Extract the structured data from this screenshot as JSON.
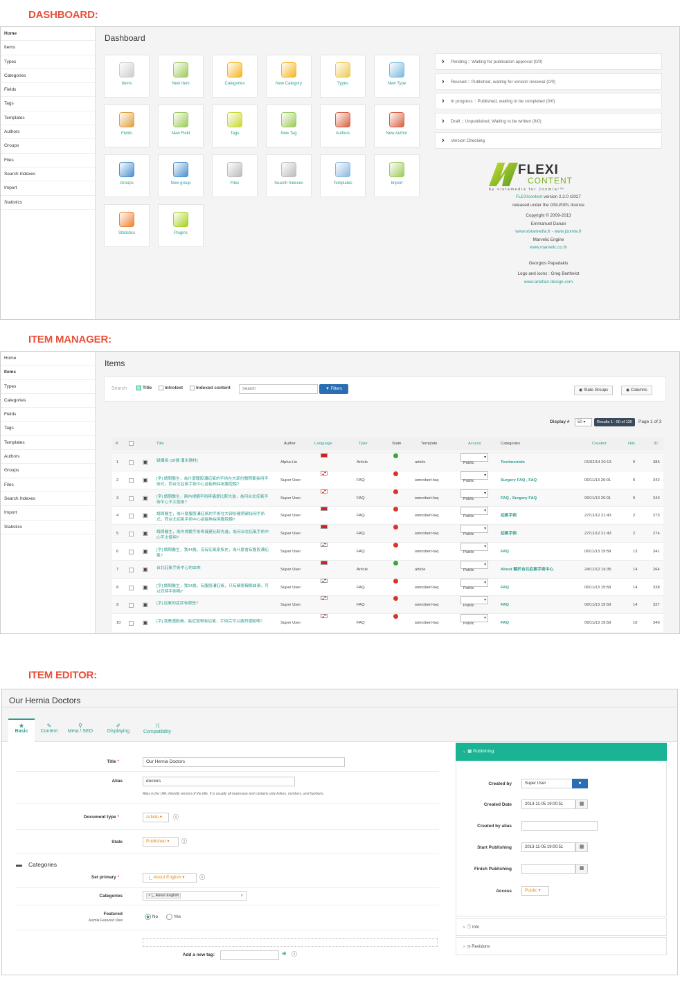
{
  "sections": {
    "dashboard": "DASHBOARD:",
    "manager": "ITEM MANAGER:",
    "editor": "ITEM EDITOR:"
  },
  "dashboard": {
    "sidebar": [
      "Home",
      "Items",
      "Types",
      "Categories",
      "Fields",
      "Tags",
      "Templates",
      "Authors",
      "Groups",
      "Files",
      "Search Indexes",
      "Import",
      "Statistics"
    ],
    "title": "Dashboard",
    "tiles": [
      {
        "label": "Items",
        "icon": "items-icon",
        "color": "#ccc"
      },
      {
        "label": "New Item",
        "icon": "new-item-icon",
        "color": "#9cca5a"
      },
      {
        "label": "Categories",
        "icon": "categories-icon",
        "color": "#f5b520"
      },
      {
        "label": "New Category",
        "icon": "new-category-icon",
        "color": "#f5b520"
      },
      {
        "label": "Types",
        "icon": "types-icon",
        "color": "#f0c850"
      },
      {
        "label": "New Type",
        "icon": "new-type-icon",
        "color": "#7ab8e0"
      },
      {
        "label": "Fields",
        "icon": "fields-icon",
        "color": "#e0a040"
      },
      {
        "label": "New Field",
        "icon": "new-field-icon",
        "color": "#9cca5a"
      },
      {
        "label": "Tags",
        "icon": "tags-icon",
        "color": "#c8d830"
      },
      {
        "label": "New Tag",
        "icon": "new-tag-icon",
        "color": "#9cca5a"
      },
      {
        "label": "Authors",
        "icon": "authors-icon",
        "color": "#d86040"
      },
      {
        "label": "New Author",
        "icon": "new-author-icon",
        "color": "#d86040"
      },
      {
        "label": "Groups",
        "icon": "groups-icon",
        "color": "#4a90d0"
      },
      {
        "label": "New group",
        "icon": "new-group-icon",
        "color": "#4a90d0"
      },
      {
        "label": "Files",
        "icon": "files-icon",
        "color": "#bbb"
      },
      {
        "label": "Search Indexes",
        "icon": "search-indexes-icon",
        "color": "#bbb"
      },
      {
        "label": "Templates",
        "icon": "templates-icon",
        "color": "#88b8e0"
      },
      {
        "label": "Import",
        "icon": "import-icon",
        "color": "#9cca5a"
      },
      {
        "label": "Statistics",
        "icon": "statistics-icon",
        "color": "#f08030"
      },
      {
        "label": "Plugins",
        "icon": "plugins-icon",
        "color": "#a8d020"
      }
    ],
    "status": [
      "Pending :: Waiting for publication approval (0/0)",
      "Revised :: Published, waiting for version reviewal (0/0)",
      "In progress :: Published, waiting to be completed (0/0)",
      "Draft :: Unpublished, Waiting to be written (0/0)",
      "Version Checking"
    ],
    "logo": {
      "main": "FLEXI",
      "sub": "CONTENT",
      "tagline": "by vistamedia for Joomla!™"
    },
    "credits": {
      "version_name": "FLEXIcontent",
      "version": "version 2.2.0 r2027",
      "licence": "released under the GNU/GPL licence",
      "copyright": "Copyright © 2009-2013",
      "author1": "Emmanuel Danan",
      "link1": "www.vistamedia.fr - www.joomla.fr",
      "engine": "Marvelic Engine",
      "link2": "www.marvelic.co.th",
      "author2": "Georgios Papadakis",
      "logo_credit": "Logo and icons : Greg Berthelot",
      "link3": "www.artefact-design.com"
    }
  },
  "manager": {
    "sidebar": [
      "Home",
      "Items",
      "Types",
      "Categories",
      "Fields",
      "Tags",
      "Templates",
      "Authors",
      "Groups",
      "Files",
      "Search Indexes",
      "Import",
      "Statistics"
    ],
    "title": "Items",
    "search_label": "Search",
    "opt_title": "Title",
    "opt_intro": "Introtext",
    "opt_indexed": "Indexed content",
    "search_placeholder": "Search",
    "filters": "Filters",
    "state_groups": "State Groups",
    "columns": "Columns",
    "display_label": "Display #",
    "display_value": "50",
    "results": "Results 1 - 50 of 130",
    "pages": "Page 1 of 3",
    "headers": [
      "#",
      "Title",
      "Author",
      "Language",
      "Type",
      "State",
      "Template",
      "Access",
      "Categories",
      "Created",
      "Hits",
      "ID"
    ],
    "rows": [
      {
        "n": "1",
        "title": "疑講長 (38號:潘永器材)",
        "author": "Alpha Lin",
        "lang": "tw",
        "type": "Article",
        "state": "ok",
        "tpl": "article",
        "access": "Public",
        "cats": "Testimonials",
        "created": "01/02/14 20:13",
        "hits": "0",
        "id": "385"
      },
      {
        "n": "2",
        "title": "[字] 請問醫生，為什麼腹股溝疝氣的手術在大部份醫院都採用手術式，而台北疝氣手術中心卻能夠採用腹腔鏡?",
        "author": "Super User",
        "lang": "uk",
        "type": "FAQ",
        "state": "no",
        "tpl": "iamrobert-faq",
        "access": "Public",
        "cats": "Surgery FAQ , FAQ",
        "created": "06/11/13 20:01",
        "hits": "0",
        "id": "342"
      },
      {
        "n": "3",
        "title": "[字] 請問醫生，兩內視鏡手術疼痛是比較先進，為何台北疝氣手術中心不太使用?",
        "author": "Super User",
        "lang": "uk",
        "type": "FAQ",
        "state": "no",
        "tpl": "iamrobert-faq",
        "access": "Public",
        "cats": "FAQ , Surgery FAQ",
        "created": "06/11/13 20:01",
        "hits": "0",
        "id": "343"
      },
      {
        "n": "4",
        "title": "請問醫生，為什麼腹股溝疝氣的手術在大部份醫院都採用手術式，而台北疝氣手術中心卻能夠採用腹腔鏡?",
        "author": "Super User",
        "lang": "tw",
        "type": "FAQ",
        "state": "no",
        "tpl": "iamrobert-faq",
        "access": "Public",
        "cats": "疝氣手術",
        "created": "27/12/12 21:43",
        "hits": "2",
        "id": "273"
      },
      {
        "n": "5",
        "title": "請問醫生，兩內視鏡手術疼痛是比較先進，為何台北疝氣手術中心不太使用?",
        "author": "Super User",
        "lang": "tw",
        "type": "FAQ",
        "state": "no",
        "tpl": "iamrobert-faq",
        "access": "Public",
        "cats": "疝氣手術",
        "created": "27/12/12 21:43",
        "hits": "2",
        "id": "274"
      },
      {
        "n": "6",
        "title": "[字] 請問醫生，我44歲，沒有疝氣家族史，為什麼會有腹股溝疝氣?",
        "author": "Super User",
        "lang": "uk",
        "type": "FAQ",
        "state": "no",
        "tpl": "iamrobert-faq",
        "access": "Public",
        "cats": "FAQ",
        "created": "06/11/13 19:58",
        "hits": "13",
        "id": "341"
      },
      {
        "n": "7",
        "title": "台北疝氣手術中心的由來",
        "author": "Super User",
        "lang": "tw",
        "type": "Article",
        "state": "ok",
        "tpl": "article",
        "access": "Public",
        "cats": "About 關於台北疝氣手術中心",
        "created": "24/12/12 16:35",
        "hits": "14",
        "id": "264"
      },
      {
        "n": "8",
        "title": "[字] 請問醫生，我24歲，有腹股溝疝氣，只有精索靜脈曲張，可以同時手術嗎?",
        "author": "Super User",
        "lang": "uk",
        "type": "FAQ",
        "state": "no",
        "tpl": "iamrobert-faq",
        "access": "Public",
        "cats": "FAQ",
        "created": "06/11/13 19:58",
        "hits": "14",
        "id": "338"
      },
      {
        "n": "9",
        "title": "[字] 疝氣的症狀有哪些?",
        "author": "Super User",
        "lang": "uk",
        "type": "FAQ",
        "state": "no",
        "tpl": "iamrobert-faq",
        "access": "Public",
        "cats": "FAQ",
        "created": "06/11/13 19:58",
        "hits": "14",
        "id": "337"
      },
      {
        "n": "10",
        "title": "[字] 我是運動員，最近發現有疝氣，手術完可以激烈運動嗎?",
        "author": "Super User",
        "lang": "uk",
        "type": "FAQ",
        "state": "no",
        "tpl": "iamrobert-faq",
        "access": "Public",
        "cats": "FAQ",
        "created": "06/11/13 19:58",
        "hits": "16",
        "id": "340"
      }
    ]
  },
  "editor": {
    "title": "Our Hernia Doctors",
    "tabs": [
      "Basic",
      "Content",
      "Meta / SEO",
      "Displaying",
      "Compatibility"
    ],
    "title_label": "Title",
    "title_value": "Our Hernia Doctors",
    "alias_label": "Alias",
    "alias_value": "doctors",
    "alias_hint": "Alias is the URL-friendly version of the title. It is usually all lowercase and contains only letters, numbers, and hyphens.",
    "doctype_label": "Document type",
    "doctype_value": "Article",
    "state_label": "State",
    "state_value": "Published",
    "categories_head": "Categories",
    "primary_label": "Set primary",
    "primary_value": ". |_ About English",
    "cats_label": "Categories",
    "cats_value": "|_ About English",
    "featured_label": "Featured",
    "featured_sub": "Joomla Featured View",
    "no": "No",
    "yes": "Yes",
    "tag_label": "Add a new tag:",
    "publishing": "Publishing",
    "created_by_label": "Created by",
    "created_by_value": "Super User",
    "created_date_label": "Created Date",
    "created_date_value": "2013-11-05 19:00:51",
    "alias_by_label": "Created by alias",
    "start_label": "Start Publishing",
    "start_value": "2013-11-05 19:00:51",
    "finish_label": "Finish Publishing",
    "access_label": "Access",
    "access_value": "Public",
    "info": "Info",
    "revisions": "Revisions"
  }
}
